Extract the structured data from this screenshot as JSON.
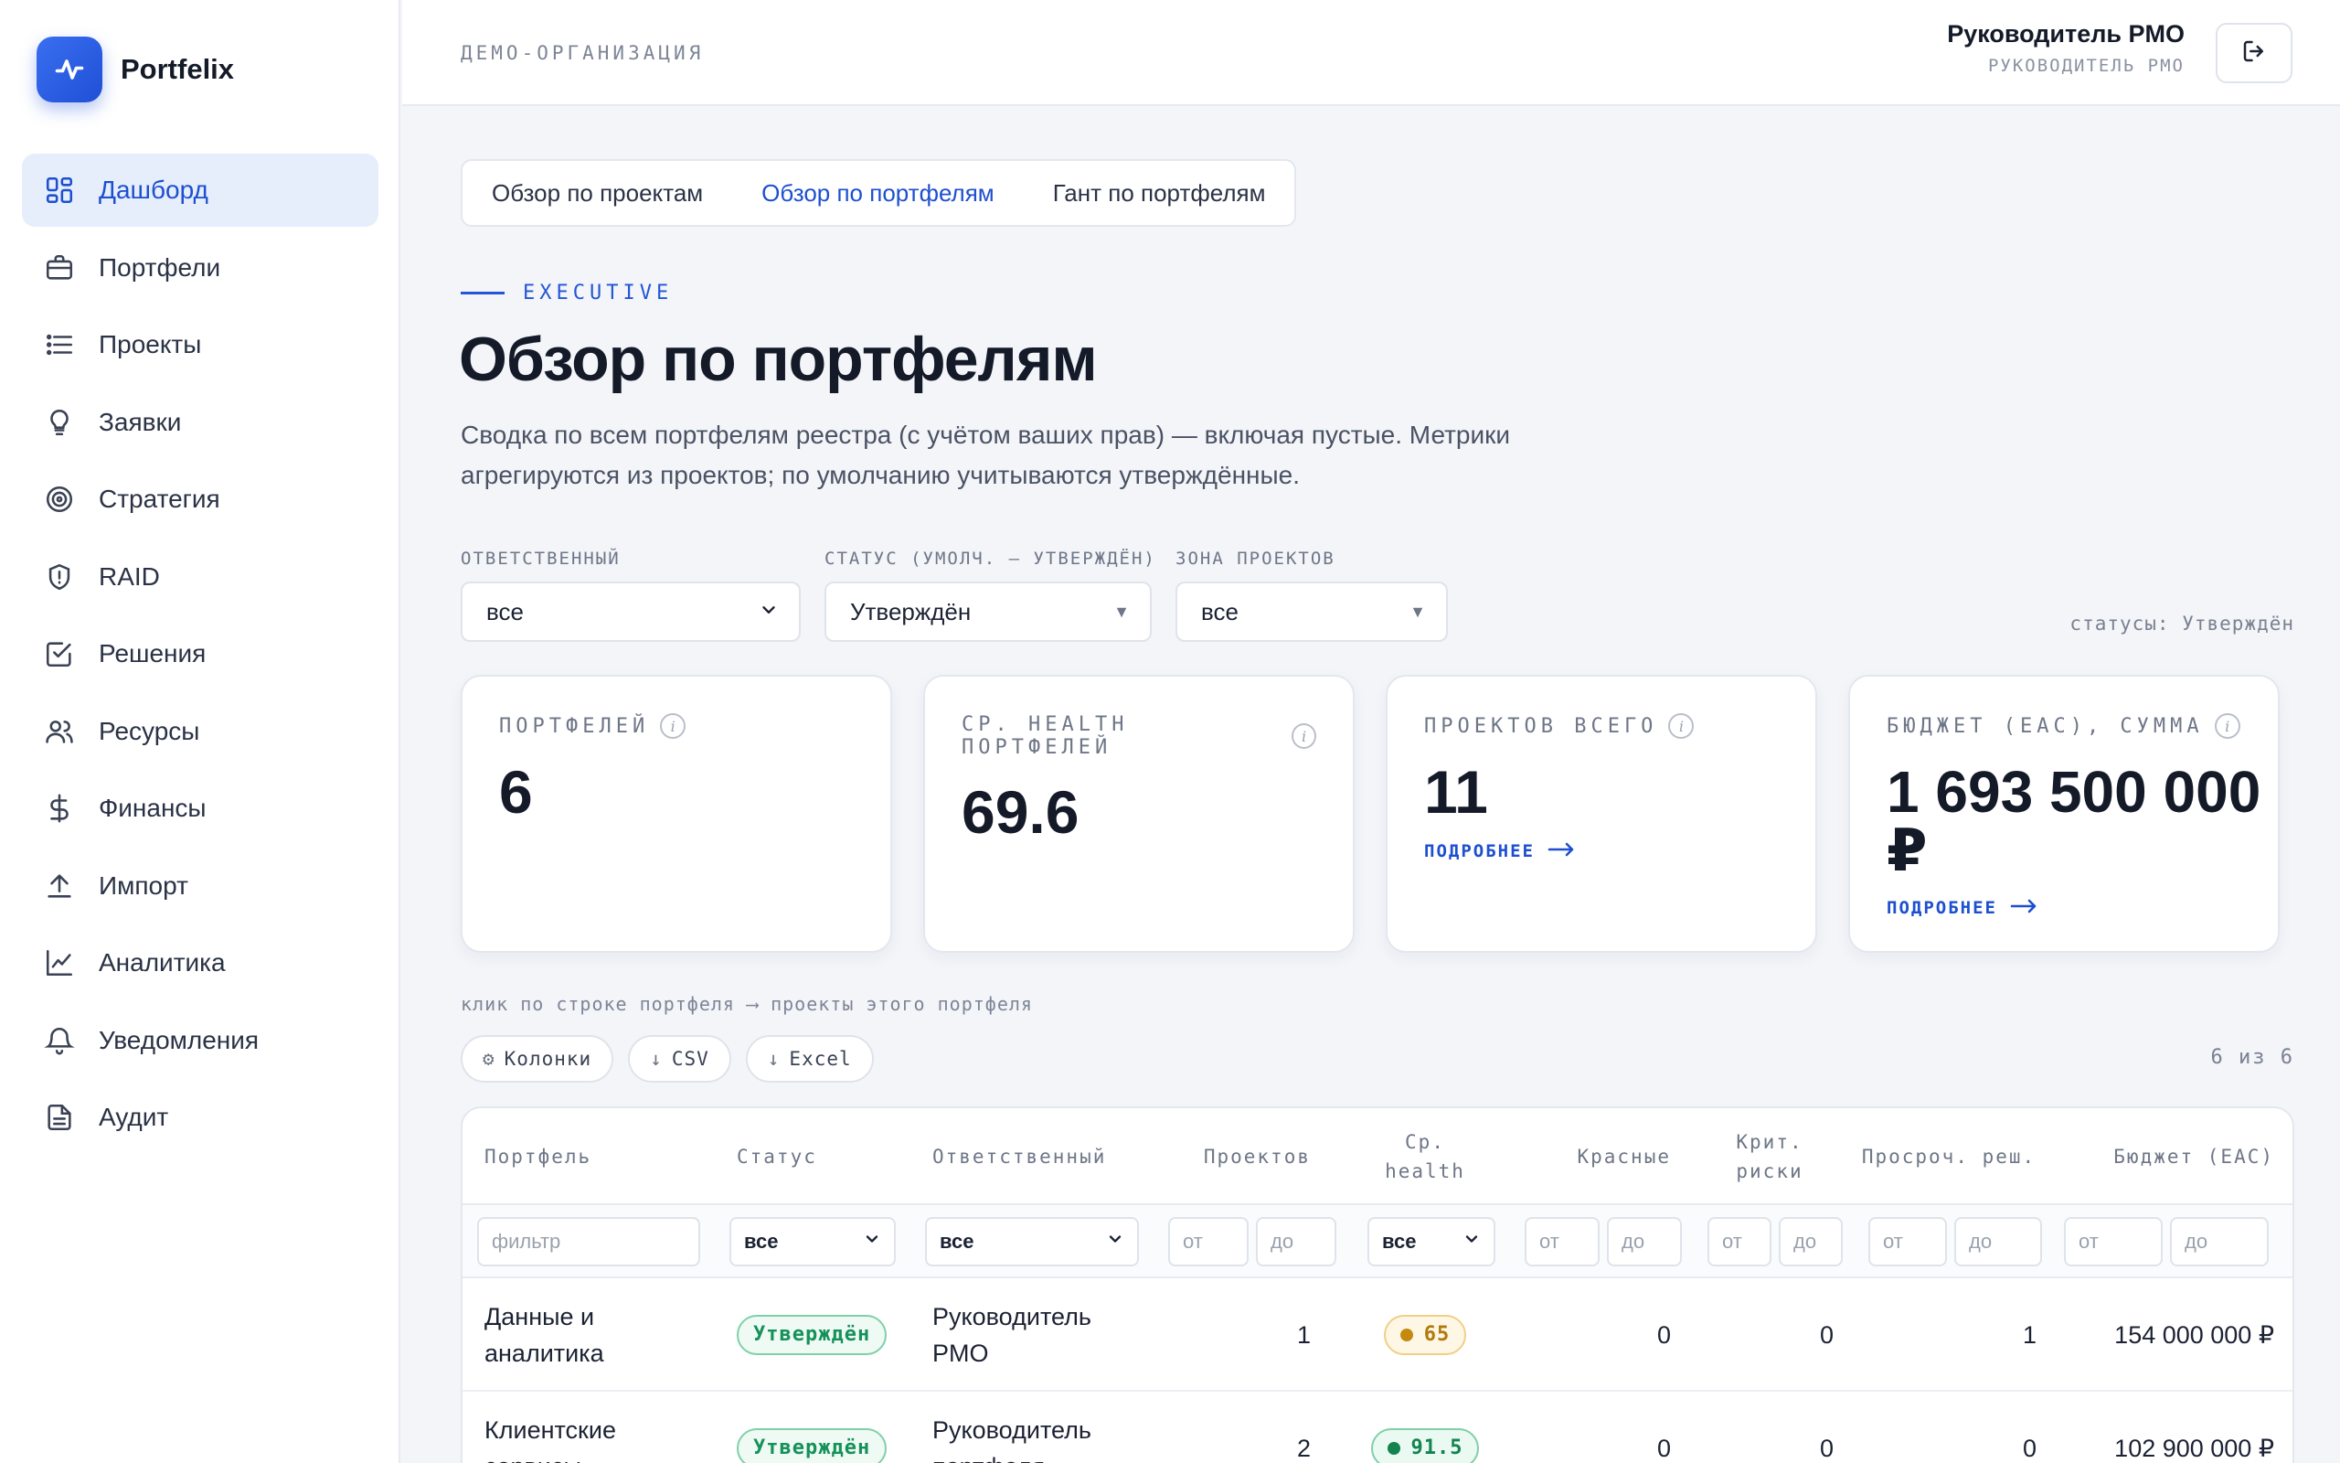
{
  "app": {
    "name": "Portfelix"
  },
  "sidebar": {
    "items": [
      {
        "label": "Дашборд",
        "icon": "dashboard-icon",
        "active": true
      },
      {
        "label": "Портфели",
        "icon": "briefcase-icon"
      },
      {
        "label": "Проекты",
        "icon": "list-icon"
      },
      {
        "label": "Заявки",
        "icon": "lightbulb-icon"
      },
      {
        "label": "Стратегия",
        "icon": "target-icon"
      },
      {
        "label": "RAID",
        "icon": "shield-icon"
      },
      {
        "label": "Решения",
        "icon": "checkbox-icon"
      },
      {
        "label": "Ресурсы",
        "icon": "users-icon"
      },
      {
        "label": "Финансы",
        "icon": "dollar-icon"
      },
      {
        "label": "Импорт",
        "icon": "upload-icon"
      },
      {
        "label": "Аналитика",
        "icon": "chart-icon"
      },
      {
        "label": "Уведомления",
        "icon": "bell-icon"
      },
      {
        "label": "Аудит",
        "icon": "document-icon"
      }
    ]
  },
  "header": {
    "org": "ДЕМО-ОРГАНИЗАЦИЯ",
    "user_name": "Руководитель PMO",
    "user_role": "РУКОВОДИТЕЛЬ PMO"
  },
  "tabs": [
    {
      "label": "Обзор по проектам"
    },
    {
      "label": "Обзор по портфелям",
      "active": true
    },
    {
      "label": "Гант по портфелям"
    }
  ],
  "page": {
    "eyebrow": "EXECUTIVE",
    "title": "Обзор по портфелям",
    "description": "Сводка по всем портфелям реестра (с учётом ваших прав) — включая пустые. Метрики агрегируются из проектов; по умолчанию учитываются утверждённые."
  },
  "filters": {
    "owner": {
      "label": "ОТВЕТСТВЕННЫЙ",
      "value": "все"
    },
    "status": {
      "label": "СТАТУС (УМОЛЧ. — УТВЕРЖДЁН)",
      "value": "Утверждён"
    },
    "zone": {
      "label": "ЗОНА ПРОЕКТОВ",
      "value": "все"
    },
    "statuses_note": "статусы: Утверждён"
  },
  "kpis": [
    {
      "label": "ПОРТФЕЛЕЙ",
      "value": "6"
    },
    {
      "label": "СР. HEALTH ПОРТФЕЛЕЙ",
      "value": "69.6"
    },
    {
      "label": "ПРОЕКТОВ ВСЕГО",
      "value": "11",
      "link": "ПОДРОБНЕЕ"
    },
    {
      "label": "БЮДЖЕТ (EAC), СУММА",
      "value_line1": "1 693 500 000",
      "value_line2": "₽",
      "link": "ПОДРОБНЕЕ"
    }
  ],
  "table": {
    "hint": "клик по строке портфеля ⟶ проекты этого портфеля",
    "toolbar": {
      "columns": "Колонки",
      "csv": "CSV",
      "excel": "Excel"
    },
    "count": "6 из 6",
    "headers": {
      "portfolio": "Портфель",
      "status": "Статус",
      "owner": "Ответственный",
      "projects": "Проектов",
      "health": "Ср. health",
      "red": "Красные",
      "crit_risks": "Крит. риски",
      "overdue": "Просроч. реш.",
      "budget": "Бюджет (EAC)"
    },
    "filter_row": {
      "text_placeholder": "фильтр",
      "all": "все",
      "from": "от",
      "to": "до"
    },
    "rows": [
      {
        "portfolio_l1": "Данные и",
        "portfolio_l2": "аналитика",
        "status": "Утверждён",
        "owner_l1": "Руководитель",
        "owner_l2": "PMO",
        "projects": "1",
        "health": "65",
        "health_color": "amber",
        "red": "0",
        "crit_risks": "0",
        "overdue": "1",
        "budget": "154 000 000 ₽"
      },
      {
        "portfolio_l1": "Клиентские",
        "portfolio_l2": "сервисы",
        "status": "Утверждён",
        "owner_l1": "Руководитель",
        "owner_l2": "портфеля",
        "projects": "2",
        "health": "91.5",
        "health_color": "green",
        "red": "0",
        "crit_risks": "0",
        "overdue": "0",
        "budget": "102 900 000 ₽"
      }
    ]
  },
  "colors": {
    "accent": "#1d4fd0",
    "success": "#15915a",
    "warning": "#c48a10"
  }
}
